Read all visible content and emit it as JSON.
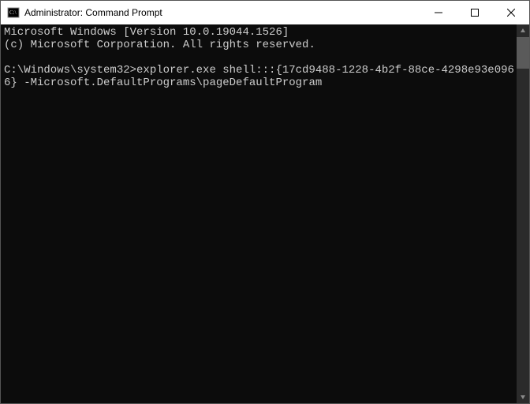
{
  "titlebar": {
    "icon_name": "cmd-icon",
    "title": "Administrator: Command Prompt"
  },
  "terminal": {
    "lines": [
      "Microsoft Windows [Version 10.0.19044.1526]",
      "(c) Microsoft Corporation. All rights reserved.",
      "",
      "C:\\Windows\\system32>explorer.exe shell:::{17cd9488-1228-4b2f-88ce-4298e93e0966} -Microsoft.DefaultPrograms\\pageDefaultProgram"
    ]
  }
}
